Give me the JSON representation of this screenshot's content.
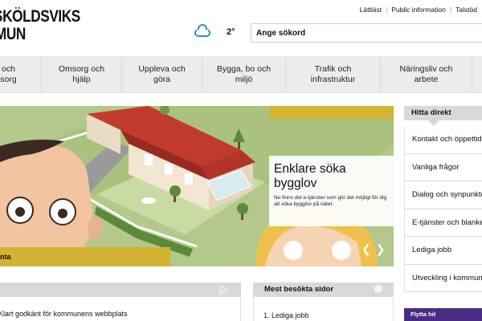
{
  "header": {
    "logo_line1": "NSKÖLDSVIKS",
    "logo_line2": "MMUN",
    "toplinks": [
      "Lättläst",
      "Public information",
      "Talstöd"
    ],
    "temperature": "2°",
    "weather_icon": "cloud-icon",
    "search_placeholder": "Ange sökord"
  },
  "nav": {
    "items": [
      {
        "line1": "och",
        "line2": "sorg"
      },
      {
        "line1": "Omsorg och",
        "line2": "hjälp"
      },
      {
        "line1": "Uppleva och",
        "line2": "göra"
      },
      {
        "line1": "Bygga, bo och",
        "line2": "miljö"
      },
      {
        "line1": "Trafik och",
        "line2": "infrastruktur"
      },
      {
        "line1": "Näringsliv och",
        "line2": "arbete"
      }
    ]
  },
  "hero": {
    "title": "Enklare söka bygglov",
    "text": "Nu finns det e-tjänster som gör det möjligt för dig att söka bygglov på nätet.",
    "ribbon_text": "nta",
    "prev_icon": "chevron-left-icon",
    "next_icon": "chevron-right-icon"
  },
  "sidebar": {
    "title": "Hitta direkt",
    "items": [
      "Kontakt och öppettider",
      "Vanliga frågor",
      "Dialog och synpunkter",
      "E-tjänster och blanketter",
      "Lediga jobb",
      "Utveckling i kommunen"
    ],
    "purple_label": "Flytta hit"
  },
  "news": {
    "rss_icon": "rss-icon",
    "first_item": "Klart godkänt för kommunens webbplats"
  },
  "popular": {
    "title": "Mest besökta sidor",
    "first_item": "1. Lediga jobb"
  },
  "colors": {
    "accent_yellow": "#d4b232",
    "purple": "#4a2c84",
    "nav_bg": "#ececec",
    "cloud_blue": "#2a8fc0"
  }
}
